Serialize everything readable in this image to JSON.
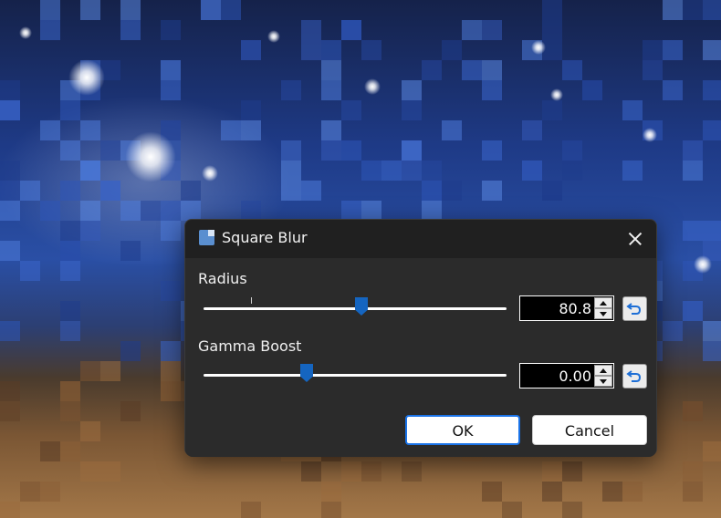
{
  "dialog": {
    "title": "Square Blur",
    "icon": "app-icon",
    "close_icon": "close-icon"
  },
  "controls": [
    {
      "label": "Radius",
      "value": "80.8",
      "slider_position": 0.52,
      "reset_icon": "reset-arrow-icon"
    },
    {
      "label": "Gamma Boost",
      "value": "0.00",
      "slider_position": 0.34,
      "reset_icon": "reset-arrow-icon"
    }
  ],
  "buttons": {
    "ok": "OK",
    "cancel": "Cancel"
  },
  "colors": {
    "accent": "#1a73e8",
    "thumb": "#1565c0",
    "dialog_bg": "#2b2b2b",
    "titlebar_bg": "#202020"
  }
}
